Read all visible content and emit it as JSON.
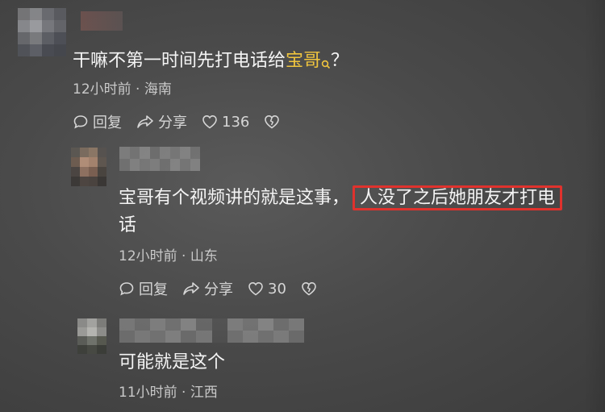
{
  "comments": [
    {
      "text_before": "干嘛不第一时间先打电话给",
      "keyword": "宝哥",
      "text_after": "？",
      "meta": "12小时前 · 海南",
      "reply_label": "回复",
      "share_label": "分享",
      "like_count": "136"
    },
    {
      "text_line1_a": "宝哥有个视频讲的就是这事，",
      "text_line1_b": "人没了之后她朋友才打电",
      "text_line2": "话",
      "meta": "12小时前 · 山东",
      "reply_label": "回复",
      "share_label": "分享",
      "like_count": "30"
    },
    {
      "text": "可能就是这个",
      "meta": "11小时前 · 江西"
    }
  ],
  "colors": {
    "keyword": "#f0c53e",
    "highlight_box": "#e0322d"
  },
  "icons": [
    "search-icon",
    "comment-icon",
    "share-icon",
    "heart-icon",
    "broken-heart-icon"
  ]
}
